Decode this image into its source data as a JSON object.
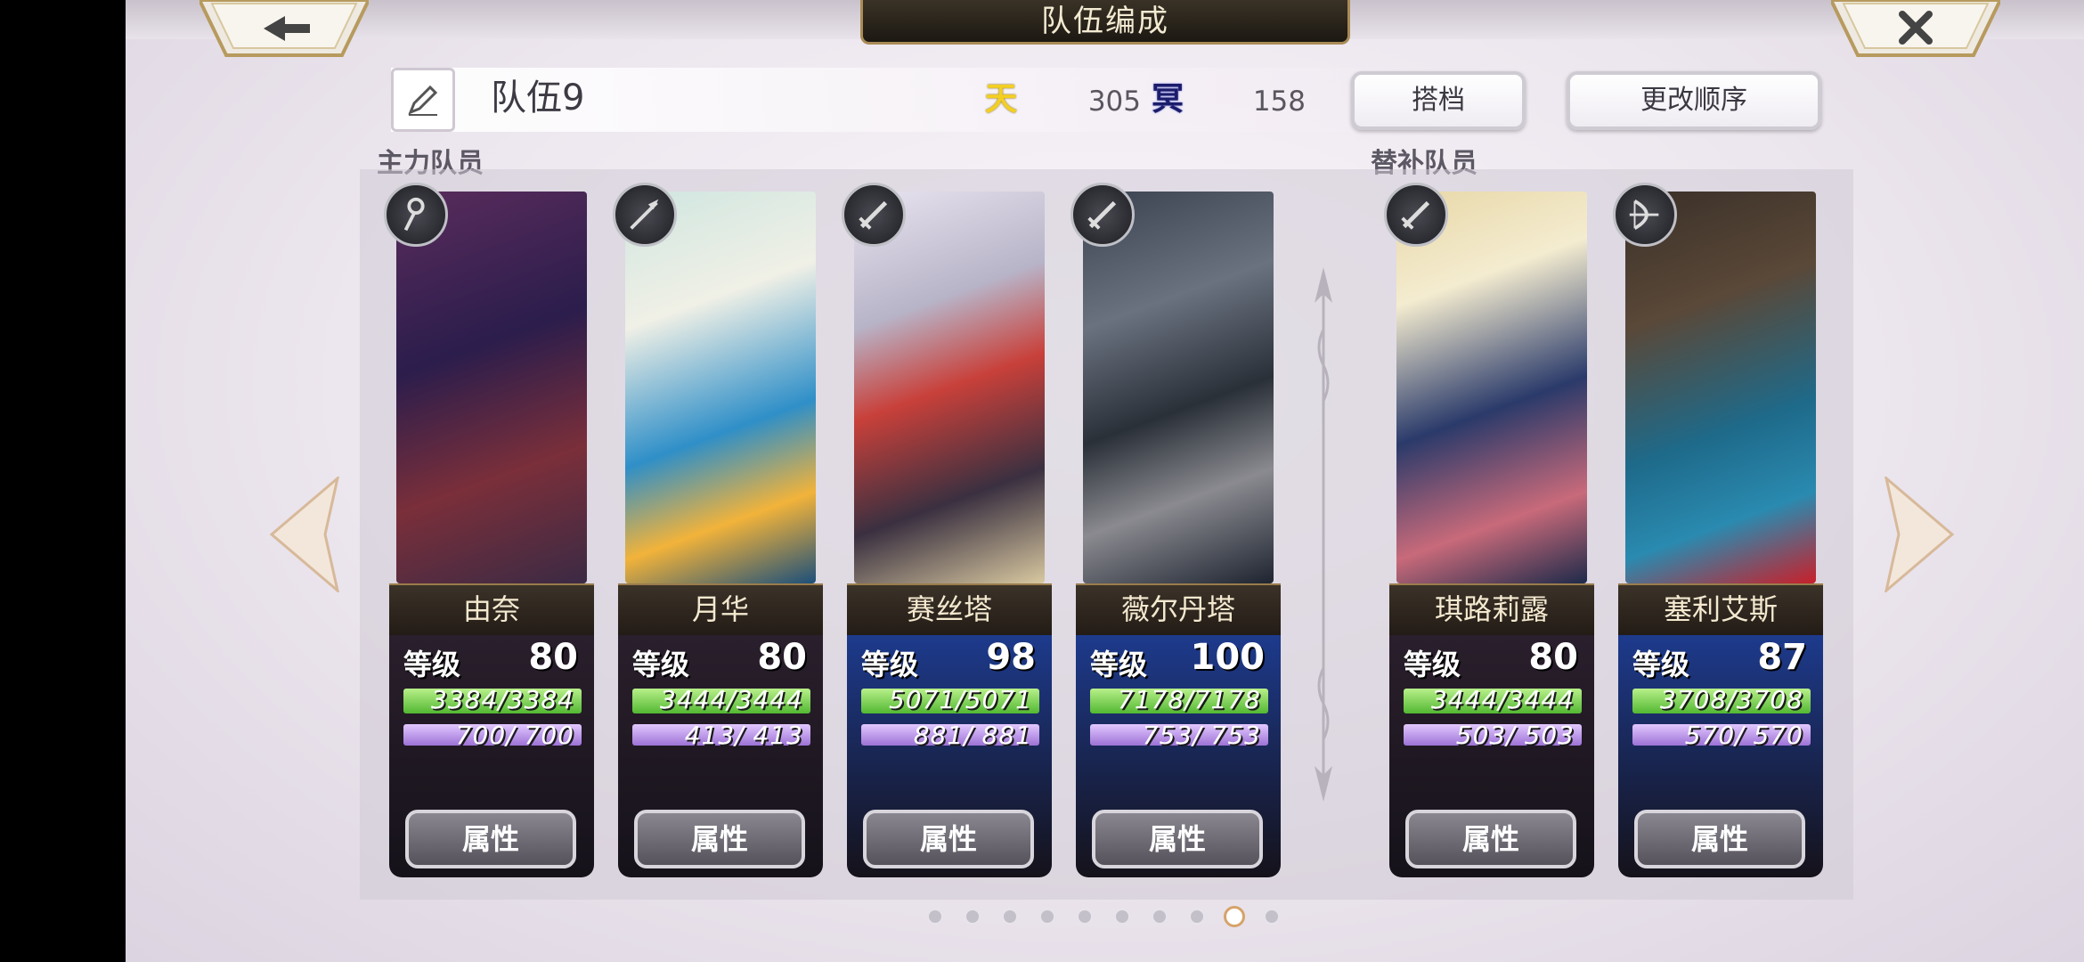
{
  "header": {
    "title": "队伍编成"
  },
  "team": {
    "name": "队伍9",
    "heaven_icon": "天",
    "heaven_value": "305",
    "hell_icon": "冥",
    "hell_value": "158"
  },
  "buttons": {
    "partner": "搭档",
    "reorder": "更改顺序"
  },
  "sections": {
    "main": "主力队员",
    "reserve": "替补队员"
  },
  "level_label": "等级",
  "attr_label": "属性",
  "members": [
    {
      "name": "由奈",
      "level": "80",
      "hp": "3384/3384",
      "mp": "700/ 700",
      "weapon": "staff-icon",
      "frame": "#2a1f2c"
    },
    {
      "name": "月华",
      "level": "80",
      "hp": "3444/3444",
      "mp": "413/ 413",
      "weapon": "spear-icon",
      "frame": "#2a1f2c"
    },
    {
      "name": "赛丝塔",
      "level": "98",
      "hp": "5071/5071",
      "mp": "881/ 881",
      "weapon": "sword-icon",
      "frame": "#1d3a8c"
    },
    {
      "name": "薇尔丹塔",
      "level": "100",
      "hp": "7178/7178",
      "mp": "753/ 753",
      "weapon": "sword-icon",
      "frame": "#1d3a8c"
    }
  ],
  "reserves": [
    {
      "name": "琪路莉露",
      "level": "80",
      "hp": "3444/3444",
      "mp": "503/ 503",
      "weapon": "sword-icon",
      "frame": "#2a1f2c"
    },
    {
      "name": "塞利艾斯",
      "level": "87",
      "hp": "3708/3708",
      "mp": "570/ 570",
      "weapon": "bow-icon",
      "frame": "#1d3a8c"
    }
  ],
  "pagination": {
    "total": 10,
    "active_index": 8
  },
  "colors": {
    "hp_bar": "#53b832",
    "mp_bar": "#9d72d6",
    "accent_gold": "#a98b55"
  }
}
